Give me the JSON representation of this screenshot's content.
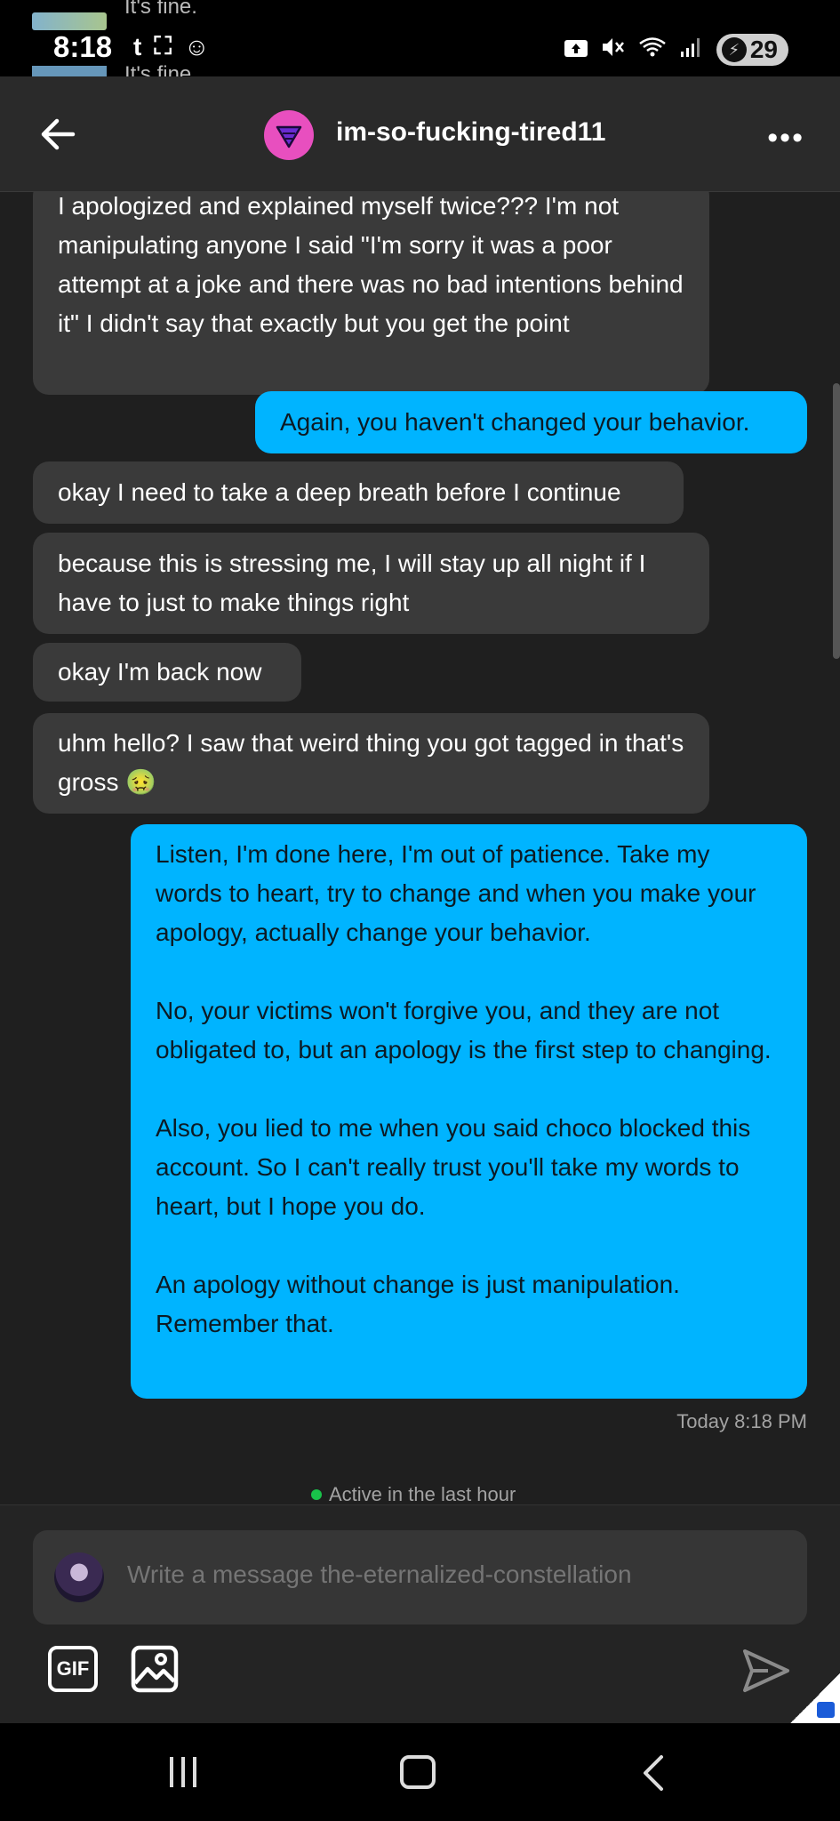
{
  "status_bar": {
    "time": "8:18",
    "app_icons": [
      "t",
      "⛶",
      "☺"
    ],
    "battery": "29",
    "behind_text_1": "It's fine.",
    "behind_text_2": "It's fine"
  },
  "header": {
    "username": "im-so-fucking-tired11"
  },
  "messages": [
    {
      "sender": "them",
      "text": "I apologized and explained myself twice??? I'm not manipulating anyone I said \"I'm sorry it was a poor attempt at a joke and there was no bad intentions behind it\" I didn't say that exactly but you get the point"
    },
    {
      "sender": "me",
      "text": "Again, you haven't changed your behavior."
    },
    {
      "sender": "them",
      "text": "okay I need to take a deep breath before I continue"
    },
    {
      "sender": "them",
      "text": "because this is stressing me, I will stay up all night if I have to just to make things right"
    },
    {
      "sender": "them",
      "text": "okay I'm back now"
    },
    {
      "sender": "them",
      "text": "uhm hello? I saw that weird thing you got tagged in that's gross 🤢"
    },
    {
      "sender": "me",
      "text": "Listen, I'm done here, I'm out of patience. Take my words to heart, try to change and when you make your apology, actually change your behavior.\n\nNo, your victims won't forgive you, and they are not obligated to, but an apology is the first step to changing.\n\nAlso, you lied to me when you said choco blocked this account. So I can't really trust you'll take my words to heart, but I hope you do.\n\nAn apology without change is just manipulation. Remember that."
    }
  ],
  "timestamp": "Today 8:18 PM",
  "activity_status": "Active in the last hour",
  "composer": {
    "placeholder": "Write a message the-eternalized-constellation",
    "gif_label": "GIF"
  },
  "colors": {
    "outgoing_bubble": "#00b4ff",
    "incoming_bubble": "#3a3a3a",
    "background": "#1f1f1f",
    "active_dot": "#19c24a",
    "avatar_pink": "#e84fbf"
  }
}
